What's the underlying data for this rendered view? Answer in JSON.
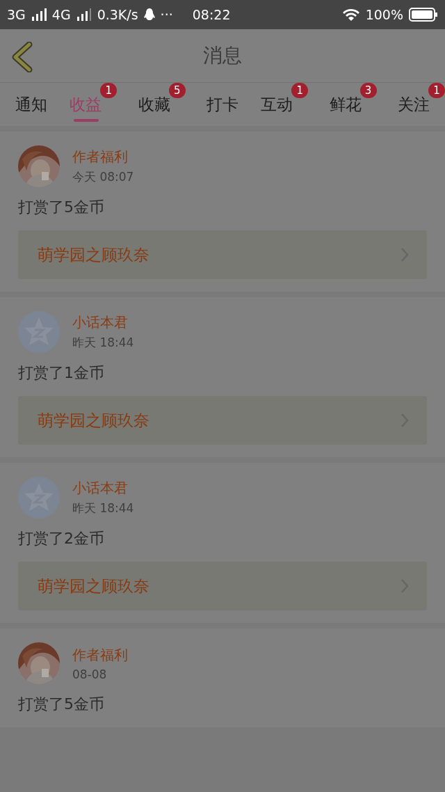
{
  "status_bar": {
    "signal_1": "3G",
    "signal_2": "4G",
    "speed": "0.3K/s",
    "more": "···",
    "time": "08:22",
    "battery": "100%"
  },
  "header": {
    "title": "消息"
  },
  "tabs": [
    {
      "label": "通知",
      "selected": false
    },
    {
      "label": "收益",
      "selected": true,
      "badge": "1"
    },
    {
      "label": "收藏",
      "selected": false,
      "badge": "5"
    },
    {
      "label": "打卡",
      "selected": false
    },
    {
      "label": "互动",
      "selected": false,
      "badge": "1"
    },
    {
      "label": "鲜花",
      "selected": false,
      "badge": "3"
    },
    {
      "label": "关注",
      "selected": false,
      "badge": "1"
    }
  ],
  "messages": [
    {
      "name": "作者福利",
      "time": "今天 08:07",
      "text": "打赏了5金币",
      "book": "萌学园之顾玖奈"
    },
    {
      "avatar": {
        "kind": "default"
      },
      "name": "小话本君",
      "time": "昨天 18:44",
      "text": "打赏了1金币",
      "book": "萌学园之顾玖奈"
    },
    {
      "avatar": {
        "kind": "default"
      },
      "name": "小话本君",
      "time": "昨天 18:44",
      "text": "打赏了2金币",
      "book": "萌学园之顾玖奈"
    },
    {
      "name": "作者福利",
      "time": "08-08",
      "text": "打赏了5金币"
    }
  ]
}
